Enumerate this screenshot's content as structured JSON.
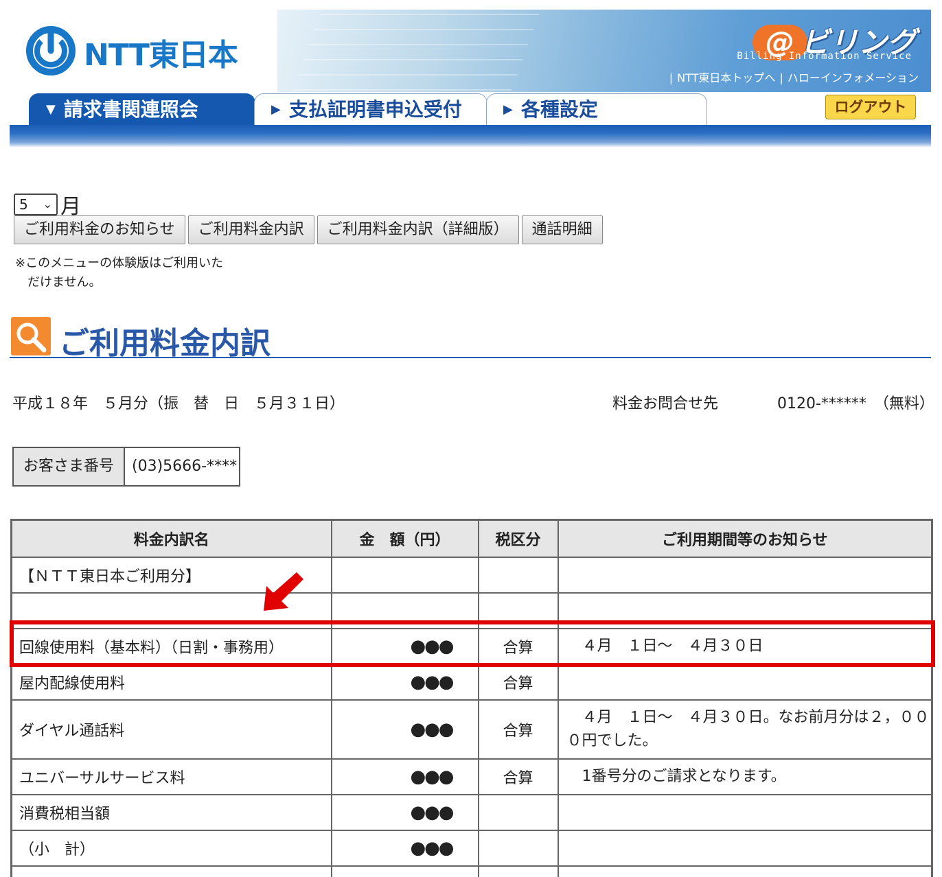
{
  "header": {
    "logo_text": "NTT東日本",
    "brand": "ビリング",
    "brand_at": "@",
    "brand_sub": "Billing Information Service",
    "top_links": [
      "NTT東日本トップへ",
      "ハローインフォメーション"
    ],
    "tabs": [
      {
        "label": "請求書関連照会",
        "marker": "▼",
        "active": true
      },
      {
        "label": "支払証明書申込受付",
        "marker": "▶",
        "active": false
      },
      {
        "label": "各種設定",
        "marker": "▶",
        "active": false
      }
    ],
    "logout_label": "ログアウト"
  },
  "controls": {
    "month_value": "5",
    "month_suffix": "月",
    "menu_buttons": [
      "ご利用料金のお知らせ",
      "ご利用料金内訳",
      "ご利用料金内訳（詳細版）",
      "通話明細"
    ],
    "note_line1": "※このメニューの体験版はご利用いた",
    "note_line2": "だけません。"
  },
  "page": {
    "title": "ご利用料金内訳",
    "period": "平成１８年　５月分（振　替　日　５月３１日）",
    "contact_label": "料金お問合せ先",
    "contact_number": "0120-******　（無料）",
    "customer_label": "お客さま番号",
    "customer_value": "(03)5666-****"
  },
  "table": {
    "headers": [
      "料金内訳名",
      "金　額（円）",
      "税区分",
      "ご利用期間等のお知らせ"
    ],
    "rows": [
      {
        "name": "【ＮＴＴ東日本ご利用分】",
        "amount": "",
        "tax": "",
        "info": ""
      },
      {
        "name": "",
        "amount": "",
        "tax": "",
        "info": ""
      },
      {
        "name": "回線使用料（基本料）（日割・事務用）",
        "amount": "●●●",
        "tax": "合算",
        "info": "　４月　１日～　４月３０日"
      },
      {
        "name": "屋内配線使用料",
        "amount": "●●●",
        "tax": "合算",
        "info": ""
      },
      {
        "name": "ダイヤル通話料",
        "amount": "●●●",
        "tax": "合算",
        "info": "　４月　１日～　４月３０日。なお前月分は２，０００円でした。"
      },
      {
        "name": "ユニバーサルサービス料",
        "amount": "●●●",
        "tax": "合算",
        "info": "　1番号分のご請求となります。"
      },
      {
        "name": "消費税相当額",
        "amount": "●●●",
        "tax": "",
        "info": ""
      },
      {
        "name": "（小　計）",
        "amount": "●●●",
        "tax": "",
        "info": ""
      }
    ]
  },
  "colors": {
    "accent_blue": "#1558b0",
    "logo_blue": "#1877c7",
    "highlight_red": "#e00000",
    "title_icon_orange": "#f48a2f",
    "logout_yellow": "#fad74a"
  },
  "icons": {
    "logo": "ntt-logo-icon",
    "title": "magnifier-icon",
    "pointer": "red-arrow-icon"
  }
}
